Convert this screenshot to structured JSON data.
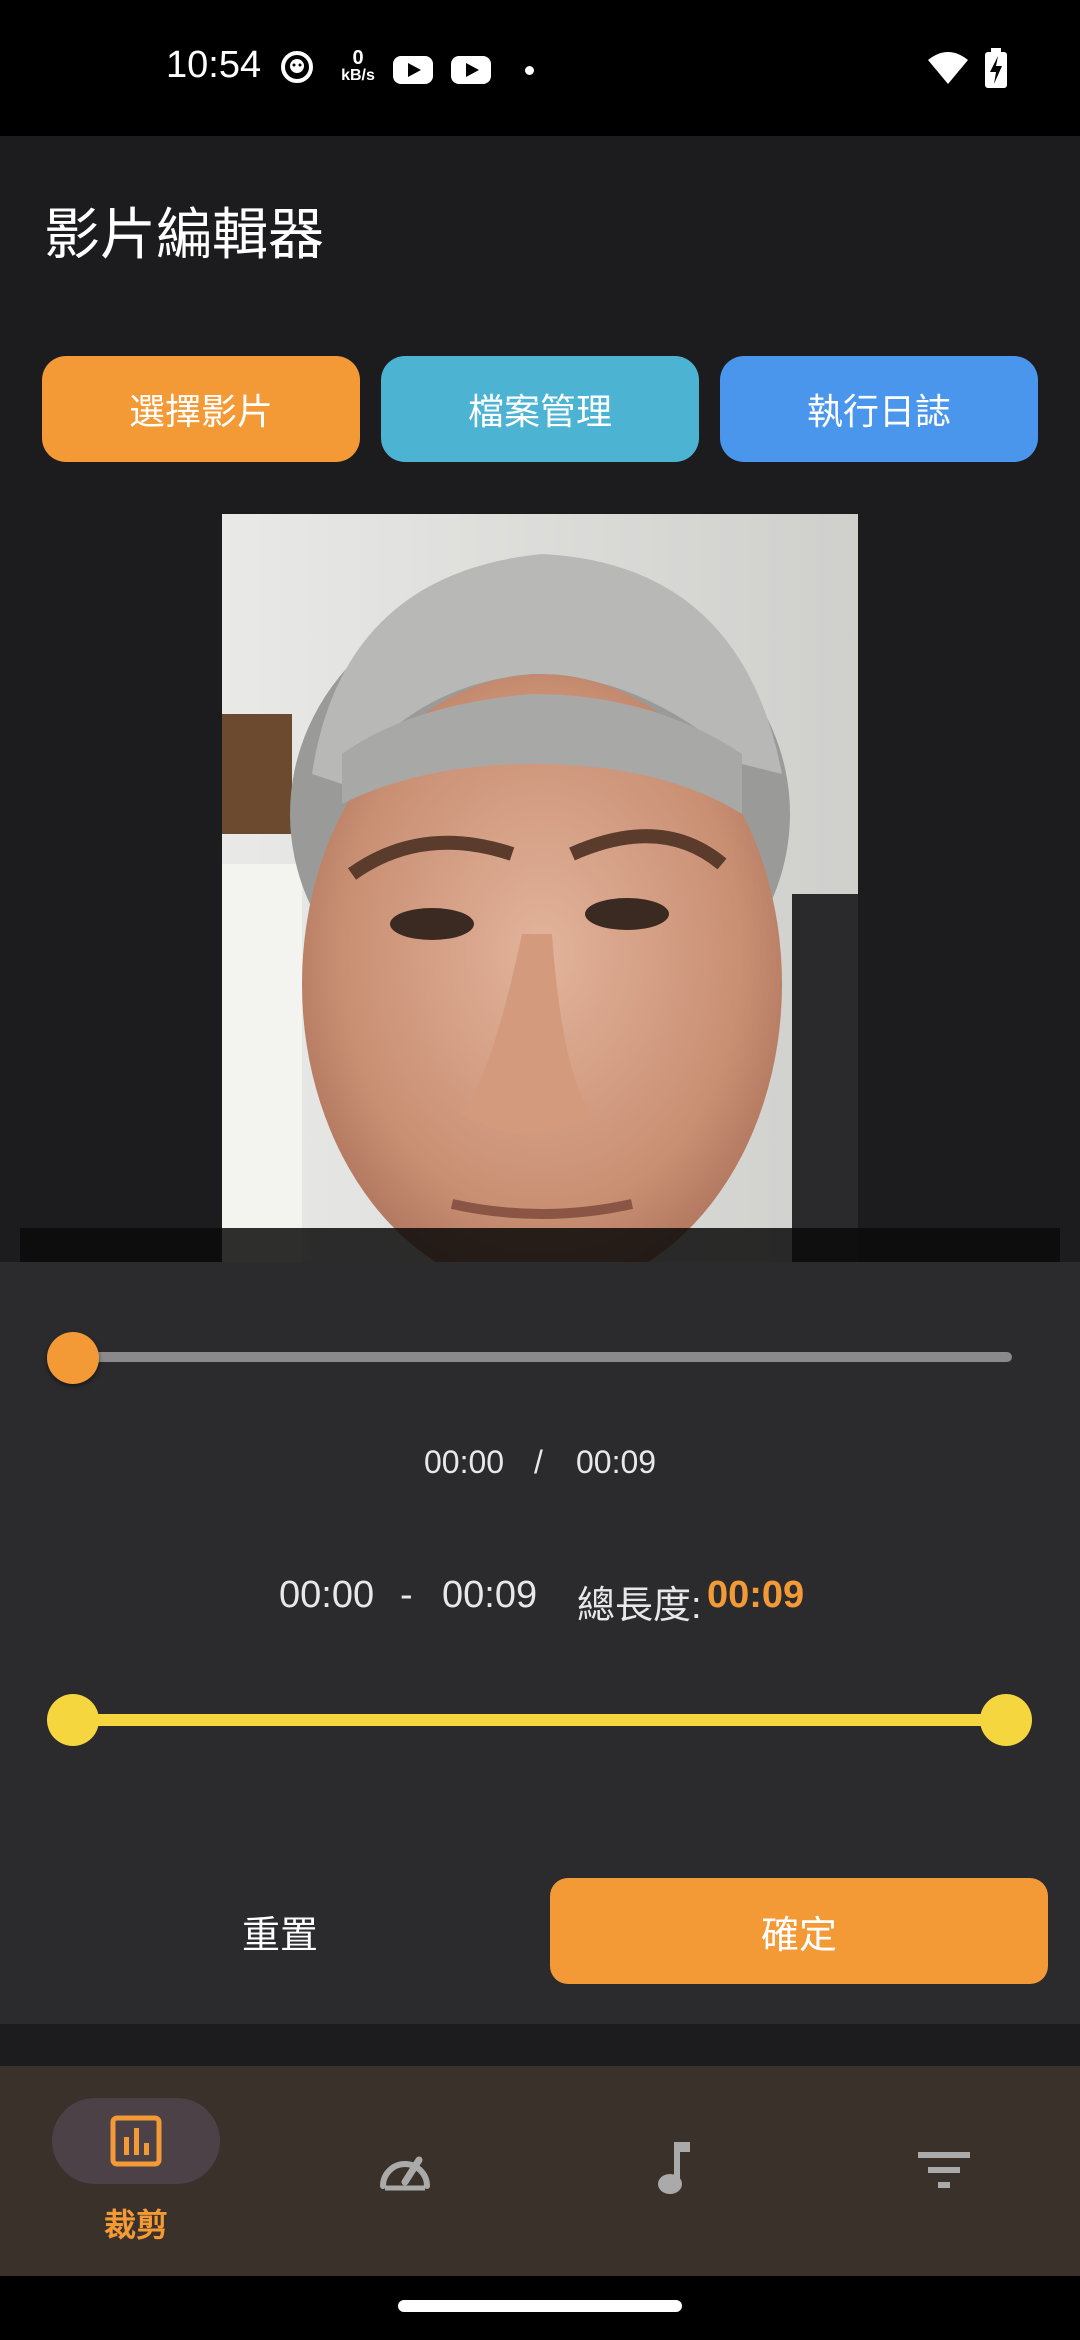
{
  "status_bar": {
    "time": "10:54",
    "net_speed_value": "0",
    "net_speed_unit": "kB/s",
    "icons": [
      "notification-face-icon",
      "youtube-icon",
      "youtube-icon",
      "dot-icon",
      "wifi-icon",
      "battery-charging-icon"
    ]
  },
  "header": {
    "title": "影片編輯器"
  },
  "top_buttons": {
    "select": "選擇影片",
    "files": "檔案管理",
    "log": "執行日誌"
  },
  "playback": {
    "current": "00:00",
    "separator": "/",
    "total": "00:09",
    "progress": 0.0
  },
  "trim": {
    "start": "00:00",
    "dash": "-",
    "end": "00:09",
    "length_label": "總長度:",
    "length_value": "00:09",
    "range_start_fraction": 0.0,
    "range_end_fraction": 1.0
  },
  "actions": {
    "reset": "重置",
    "confirm": "確定"
  },
  "bottom_nav": {
    "active_label": "裁剪",
    "items": [
      "trim-icon",
      "speed-icon",
      "music-icon",
      "filter-icon"
    ]
  },
  "colors": {
    "accent_orange": "#f39a36",
    "files_blue": "#4cb3d3",
    "log_blue": "#4a96ec",
    "range_yellow": "#f6d63e"
  }
}
